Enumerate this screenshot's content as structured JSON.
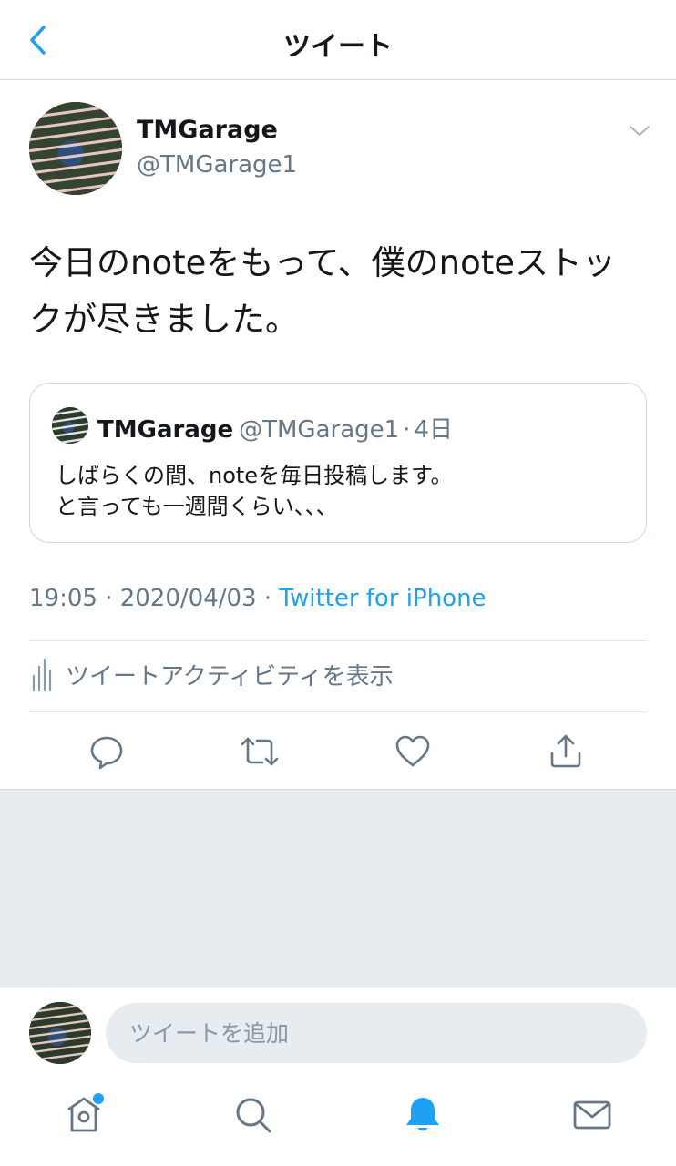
{
  "header": {
    "title": "ツイート"
  },
  "tweet": {
    "author": {
      "name": "TMGarage",
      "handle": "@TMGarage1"
    },
    "text": "今日のnoteをもって、僕のnoteストックが尽きました。",
    "timestamp": "19:05 · 2020/04/03 · ",
    "source": "Twitter for iPhone",
    "activity_label": "ツイートアクティビティを表示"
  },
  "quoted_tweet": {
    "name": "TMGarage",
    "handle": "@TMGarage1",
    "separator": "·",
    "time": "4日",
    "lines": [
      "しばらくの間、noteを毎日投稿します。",
      "と言っても一週間くらい、、、"
    ]
  },
  "actions": {
    "icons": [
      "reply-icon",
      "retweet-icon",
      "like-icon",
      "share-icon"
    ]
  },
  "reply": {
    "placeholder": "ツイートを追加"
  },
  "tabs": {
    "icons": [
      "home-icon",
      "search-icon",
      "notifications-icon",
      "messages-icon"
    ],
    "active": "notifications-icon"
  },
  "colors": {
    "accent": "#1da1f2",
    "secondary_text": "#657786",
    "background_gray": "#e6ecf0"
  }
}
